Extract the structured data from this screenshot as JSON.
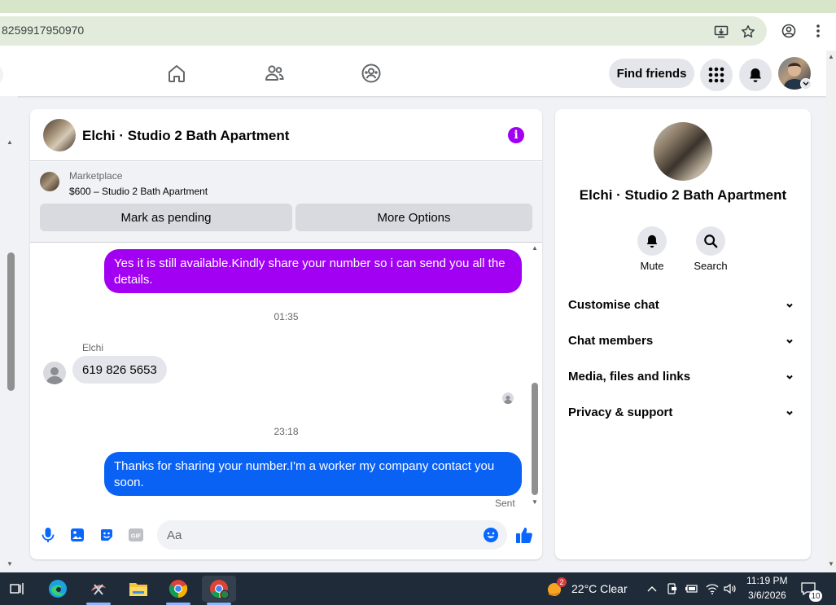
{
  "browser": {
    "url": "8259917950970"
  },
  "nav": {
    "find_friends_label": "Find friends"
  },
  "chat": {
    "title": "Elchi · Studio 2 Bath Apartment",
    "marketplace": {
      "label": "Marketplace",
      "listing": "$600 – Studio 2 Bath Apartment",
      "mark_pending_label": "Mark as pending",
      "more_options_label": "More Options"
    },
    "messages": [
      {
        "type": "outgoing",
        "text": "Yes it is still available.Kindly share your number so i can send you all the details.",
        "color": "#a100f2"
      },
      {
        "type": "time",
        "text": "01:35"
      },
      {
        "type": "incoming",
        "sender": "Elchi",
        "text": "619 826 5653"
      },
      {
        "type": "time",
        "text": "23:18"
      },
      {
        "type": "outgoing",
        "text": "Thanks for sharing your number.I'm a worker my company contact you soon.",
        "color": "#0a62f5",
        "status": "Sent"
      }
    ],
    "composer": {
      "placeholder": "Aa"
    }
  },
  "info_panel": {
    "name": "Elchi · Studio 2 Bath Apartment",
    "actions": [
      {
        "label": "Mute",
        "icon": "bell-icon"
      },
      {
        "label": "Search",
        "icon": "search-icon"
      }
    ],
    "sections": [
      {
        "label": "Customise chat"
      },
      {
        "label": "Chat members"
      },
      {
        "label": "Media, files and links"
      },
      {
        "label": "Privacy & support"
      }
    ]
  },
  "taskbar": {
    "weather_badge": "2",
    "weather": "22°C  Clear",
    "time": "11:19 PM",
    "date": "3/6/2026",
    "notification_count": "10"
  },
  "colors": {
    "accent_blue": "#0866ff",
    "purple": "#a100f2",
    "taskbar": "#1f2b38"
  }
}
